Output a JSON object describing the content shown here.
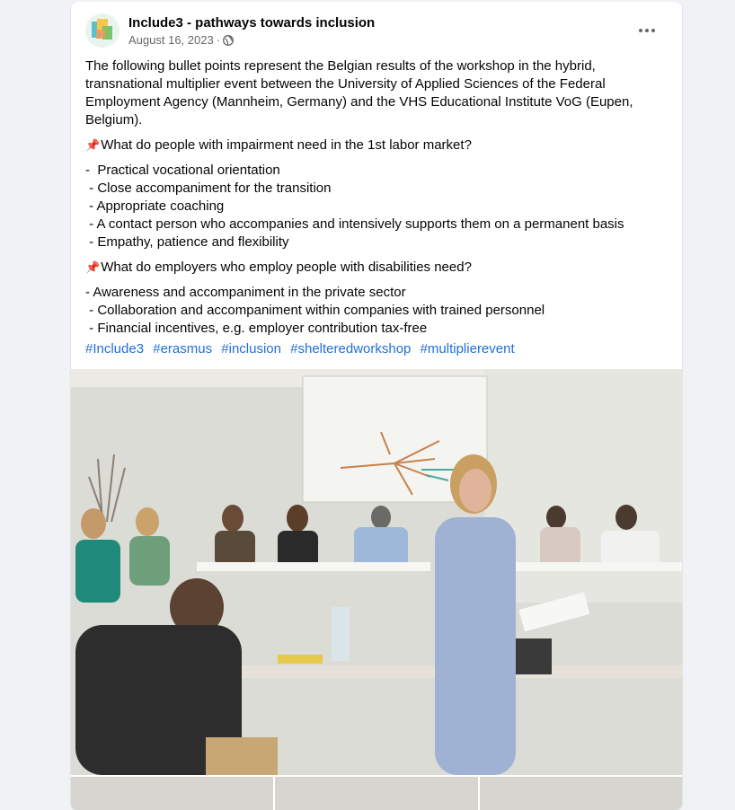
{
  "post": {
    "author": "Include3 - pathways towards inclusion",
    "date": "August 16, 2023",
    "separator": "·",
    "audience_icon": "globe-icon",
    "more_icon": "more-options-icon",
    "intro": "The following bullet points represent the Belgian results of the workshop in the hybrid, transnational multiplier event between the University of Applied Sciences of the Federal Employment Agency (Mannheim, Germany) and the VHS Educational Institute VoG (Eupen, Belgium).",
    "question1": "What do people with impairment need in the 1st labor market?",
    "answers1": [
      "-  Practical vocational orientation",
      " - Close accompaniment for the transition",
      " - Appropriate coaching",
      " - A contact person who accompanies and intensively supports them on a permanent basis",
      " - Empathy, patience and flexibility"
    ],
    "question2": "What do employers who employ people with disabilities need?",
    "answers2": [
      "- Awareness and accompaniment in the private sector",
      " - Collaboration and accompaniment within companies with trained personnel",
      " - Financial incentives, e.g. employer contribution tax-free"
    ],
    "pin_icon": "pushpin-icon",
    "hashtags": [
      "#Include3",
      "#erasmus",
      "#inclusion",
      "#shelteredworkshop",
      "#multiplierevent"
    ]
  },
  "colors": {
    "background": "#f0f2f5",
    "link": "#216fdb",
    "secondary_text": "#65676b",
    "pin": "#d9364b"
  }
}
